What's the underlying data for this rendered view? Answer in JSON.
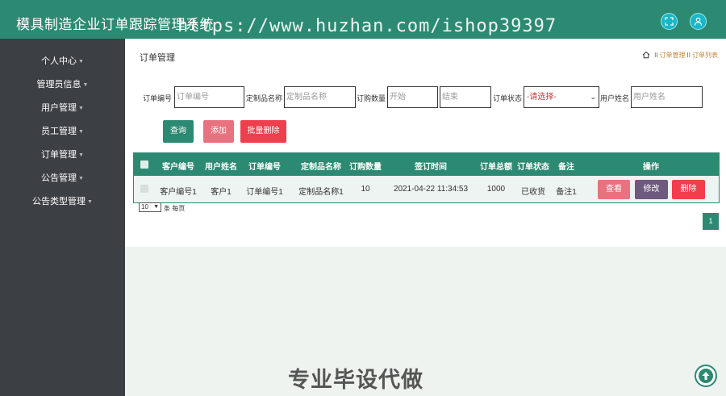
{
  "header": {
    "app_title": "模具制造企业订单跟踪管理系统",
    "watermark_url": "https://www.huzhan.com/ishop39397"
  },
  "sidebar": {
    "items": [
      {
        "label": "个人中心"
      },
      {
        "label": "管理员信息"
      },
      {
        "label": "用户管理"
      },
      {
        "label": "员工管理"
      },
      {
        "label": "订单管理"
      },
      {
        "label": "公告管理"
      },
      {
        "label": "公告类型管理"
      }
    ]
  },
  "main": {
    "page_title": "订单管理",
    "breadcrumb": {
      "sep": "II",
      "items": [
        "订单管理",
        "订单列表"
      ]
    }
  },
  "search": {
    "order_no_label": "订单编号",
    "order_no_placeholder": "订单编号",
    "product_label": "定制品名称",
    "product_placeholder": "定制品名称",
    "qty_label": "订购数量",
    "qty_start_placeholder": "开始",
    "qty_end_placeholder": "结束",
    "status_label": "订单状态",
    "status_selected": "-请选择-",
    "user_label": "用户姓名",
    "user_placeholder": "用户姓名"
  },
  "actions": {
    "query": "查询",
    "add": "添加",
    "batch_delete": "批量删除"
  },
  "table": {
    "headers": [
      "客户编号",
      "用户姓名",
      "订单编号",
      "定制品名称",
      "订购数量",
      "签订时间",
      "订单总额",
      "订单状态",
      "备注",
      "操作"
    ],
    "rows": [
      {
        "cells": [
          "客户编号1",
          "客户1",
          "订单编号1",
          "定制品名称1",
          "10",
          "2021-04-22 11:34:53",
          "1000",
          "已收货",
          "备注1"
        ],
        "view": "查看",
        "edit": "修改",
        "delete": "删除"
      }
    ]
  },
  "pagination": {
    "page_size": "10",
    "per_page_label": "条 每页",
    "current_page": "1"
  },
  "footer": {
    "watermark_text": "专业毕设代做"
  },
  "colors": {
    "brand": "#2d8a72",
    "sidebar": "#3c3f44",
    "add_button": "#e8727f",
    "delete_button": "#ef3e4c",
    "edit_button": "#6e5a7e"
  }
}
